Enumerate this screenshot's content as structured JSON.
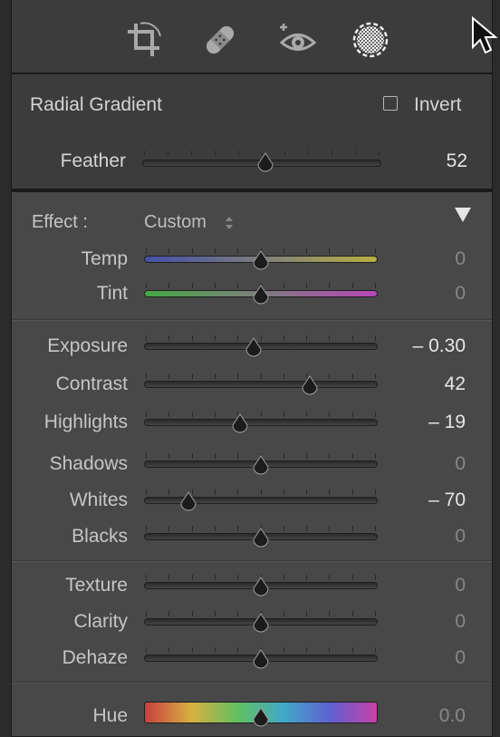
{
  "toolbar": {
    "tools": [
      {
        "icon": "crop-icon"
      },
      {
        "icon": "healing-bandage-icon"
      },
      {
        "icon": "red-eye-icon"
      },
      {
        "icon": "radial-mask-icon",
        "active": true
      }
    ]
  },
  "radial_gradient": {
    "title": "Radial Gradient",
    "invert_label": "Invert",
    "invert_checked": false,
    "feather": {
      "label": "Feather",
      "value": "52",
      "level": 52
    }
  },
  "effect": {
    "label": "Effect :",
    "preset": "Custom"
  },
  "sliders": [
    {
      "key": "temp",
      "label": "Temp",
      "value": "0",
      "level": 0.5,
      "kind": "temp"
    },
    {
      "key": "tint",
      "label": "Tint",
      "value": "0",
      "level": 0.5,
      "kind": "tint"
    },
    {
      "key": "exposure",
      "label": "Exposure",
      "value": "– 0.30",
      "level": 0.47,
      "kind": "plain"
    },
    {
      "key": "contrast",
      "label": "Contrast",
      "value": "42",
      "level": 0.71,
      "kind": "plain"
    },
    {
      "key": "highlights",
      "label": "Highlights",
      "value": "– 19",
      "level": 0.41,
      "kind": "plain"
    },
    {
      "key": "shadows",
      "label": "Shadows",
      "value": "0",
      "level": 0.5,
      "kind": "plain"
    },
    {
      "key": "whites",
      "label": "Whites",
      "value": "– 70",
      "level": 0.19,
      "kind": "plain"
    },
    {
      "key": "blacks",
      "label": "Blacks",
      "value": "0",
      "level": 0.5,
      "kind": "plain"
    },
    {
      "key": "texture",
      "label": "Texture",
      "value": "0",
      "level": 0.5,
      "kind": "plain"
    },
    {
      "key": "clarity",
      "label": "Clarity",
      "value": "0",
      "level": 0.5,
      "kind": "plain"
    },
    {
      "key": "dehaze",
      "label": "Dehaze",
      "value": "0",
      "level": 0.5,
      "kind": "plain"
    },
    {
      "key": "hue",
      "label": "Hue",
      "value": "0.0",
      "level": 0.5,
      "kind": "hue"
    }
  ]
}
